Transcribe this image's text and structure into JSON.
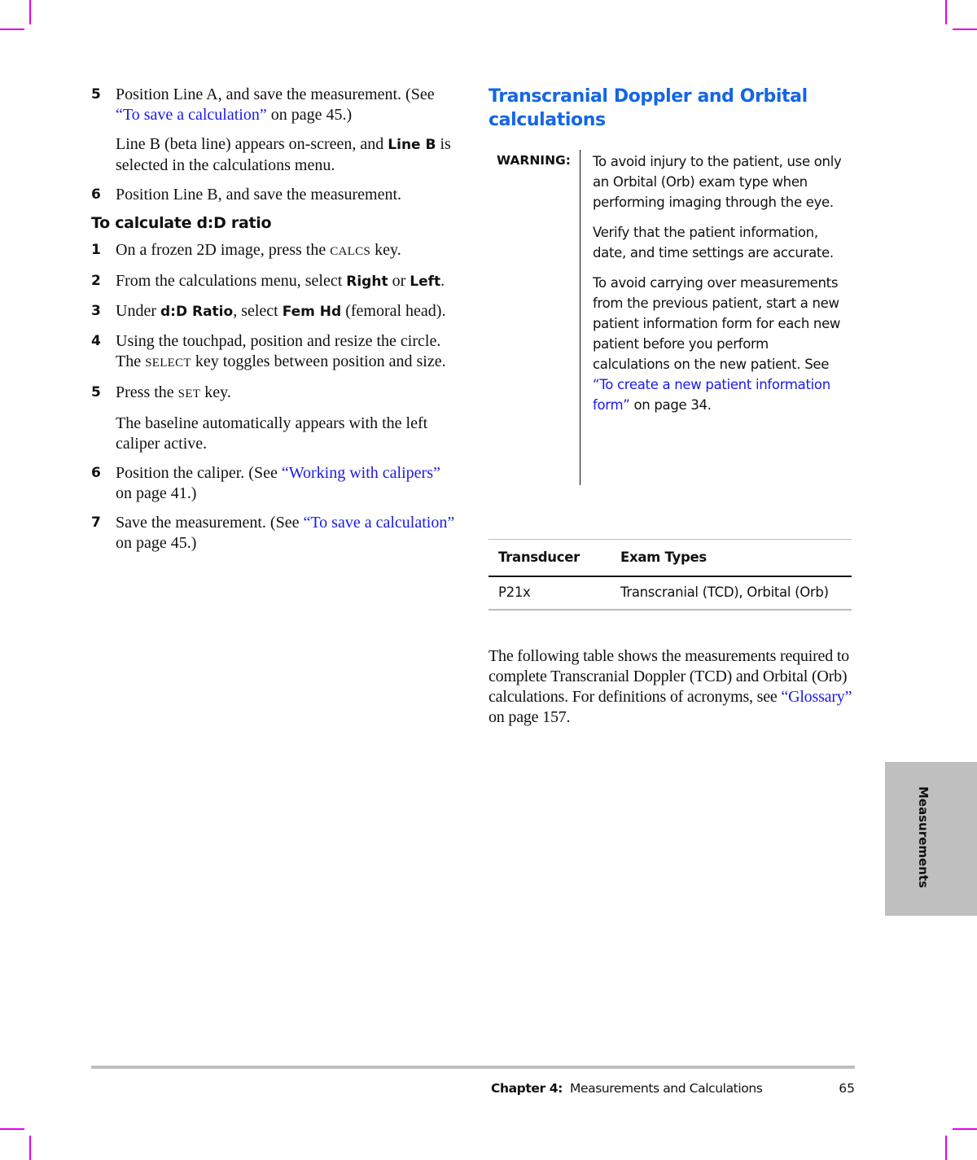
{
  "left_column": {
    "steps_a": [
      {
        "num": "5",
        "text": "Position Line A, and save the measurement. (See ",
        "link": "“To save a calculation”",
        "after": " on page 45.)"
      },
      {
        "num": "6",
        "text": "Position Line B, and save the measurement."
      }
    ],
    "note_line_b": {
      "pre": "Line B (beta line) appears on-screen, and ",
      "bold": "Line B",
      "post": " is selected in the calculations menu."
    },
    "subheading": "To calculate d:D ratio",
    "steps_b": [
      {
        "num": "1",
        "pre": "On a frozen 2D image, press the ",
        "key": "CALCS",
        "post": " key."
      },
      {
        "num": "2",
        "pre": "From the calculations menu, select ",
        "bold1": "Right",
        "mid": " or ",
        "bold2": "Left",
        "post": "."
      },
      {
        "num": "3",
        "pre": "Under ",
        "bold1": "d:D Ratio",
        "mid": ", select ",
        "bold2": "Fem Hd",
        "post": " (femoral head)."
      },
      {
        "num": "4",
        "pre": "Using the touchpad, position and resize the circle. The ",
        "key": "SELECT",
        "post": " key toggles between position and size."
      },
      {
        "num": "5",
        "pre": "Press the ",
        "key": "SET",
        "post": " key."
      },
      {
        "num": "6",
        "pre": "Position the caliper. (See ",
        "link": "“Working with calipers”",
        "post": " on page 41.)"
      },
      {
        "num": "7",
        "pre": "Save the measurement. (See ",
        "link": "“To save a calculation”",
        "post": " on page 45.)"
      }
    ],
    "note_baseline": "The baseline automatically appears with the left caliper active."
  },
  "right_column": {
    "heading": "Transcranial Doppler and Orbital calculations",
    "warning": {
      "label": "WARNING:",
      "paragraphs": [
        "To avoid injury to the patient, use only an Orbital (Orb) exam type when performing imaging through the eye.",
        "Verify that the patient information, date, and time settings are accurate."
      ],
      "last_pre": "To avoid carrying over measurements from the previous patient, start a new patient information form for each new patient before you perform calculations on the new patient. See ",
      "last_link": "“To create a new patient information form”",
      "last_post": " on page 34."
    },
    "table": {
      "headers": [
        "Transducer",
        "Exam Types"
      ],
      "rows": [
        [
          "P21x",
          "Transcranial (TCD), Orbital (Orb)"
        ]
      ]
    },
    "closing": {
      "pre": "The following table shows the measurements required to complete Transcranial Doppler (TCD) and Orbital (Orb) calculations. For definitions of acronyms, see ",
      "link": "“Glossary”",
      "post": " on page 157."
    }
  },
  "side_tab": "Measurements",
  "footer": {
    "chapter_label": "Chapter 4:",
    "chapter_title": "Measurements and Calculations",
    "page_number": "65"
  },
  "colors": {
    "heading_blue": "#1466e6",
    "link_blue": "#1a1ae6",
    "crop_mark": "#e600e6",
    "tab_gray": "#bfbfbf"
  }
}
